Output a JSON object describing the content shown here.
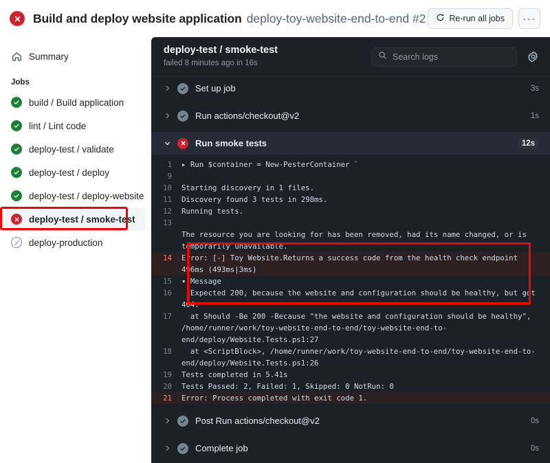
{
  "header": {
    "status_icon": "x-circle-icon",
    "status_color": "#cf222e",
    "title": "Build and deploy website application",
    "subtitle": "deploy-toy-website-end-to-end #2",
    "rerun_label": "Re-run all jobs",
    "rerun_icon": "sync-icon",
    "kebab_label": "···"
  },
  "sidebar": {
    "summary": {
      "label": "Summary",
      "icon": "home-icon"
    },
    "jobs_heading": "Jobs",
    "jobs": [
      {
        "label": "build / Build application",
        "status": "success",
        "icon": "check-circle-icon",
        "selected": false
      },
      {
        "label": "lint / Lint code",
        "status": "success",
        "icon": "check-circle-icon",
        "selected": false
      },
      {
        "label": "deploy-test / validate",
        "status": "success",
        "icon": "check-circle-icon",
        "selected": false
      },
      {
        "label": "deploy-test / deploy",
        "status": "success",
        "icon": "check-circle-icon",
        "selected": false
      },
      {
        "label": "deploy-test / deploy-website",
        "status": "success",
        "icon": "check-circle-icon",
        "selected": false
      },
      {
        "label": "deploy-test / smoke-test",
        "status": "failure",
        "icon": "x-circle-icon",
        "selected": true
      },
      {
        "label": "deploy-production",
        "status": "skipped",
        "icon": "skip-circle-icon",
        "selected": false
      }
    ]
  },
  "log_panel": {
    "job_name": "deploy-test / smoke-test",
    "job_status_line": "failed 8 minutes ago in 16s",
    "search": {
      "placeholder": "Search logs",
      "value": "",
      "icon": "search-icon"
    },
    "settings_icon": "gear-icon",
    "steps_top": [
      {
        "name": "Set up job",
        "duration": "3s",
        "status": "success",
        "expanded": false,
        "chevron": "chevron-right-icon"
      },
      {
        "name": "Run actions/checkout@v2",
        "duration": "1s",
        "status": "success",
        "expanded": false,
        "chevron": "chevron-right-icon"
      },
      {
        "name": "Run smoke tests",
        "duration": "12s",
        "status": "failure",
        "expanded": true,
        "chevron": "chevron-down-icon"
      }
    ],
    "steps_bottom": [
      {
        "name": "Post Run actions/checkout@v2",
        "duration": "0s",
        "status": "success",
        "expanded": false,
        "chevron": "chevron-right-icon"
      },
      {
        "name": "Complete job",
        "duration": "0s",
        "status": "success",
        "expanded": false,
        "chevron": "chevron-right-icon"
      }
    ],
    "log_lines": [
      {
        "n": "1",
        "text": "▸ Run $container = New-PesterContainer `",
        "error": false
      },
      {
        "n": "9",
        "text": "",
        "error": false
      },
      {
        "n": "10",
        "text": "Starting discovery in 1 files.",
        "error": false
      },
      {
        "n": "11",
        "text": "Discovery found 3 tests in 298ms.",
        "error": false
      },
      {
        "n": "12",
        "text": "Running tests.",
        "error": false
      },
      {
        "n": "13",
        "text": "",
        "error": false
      },
      {
        "n": "",
        "text": "The resource you are looking for has been removed, had its name changed, or is temporarily unavailable.",
        "error": false
      },
      {
        "n": "14",
        "text": "Error: [-] Toy Website.Returns a success code from the health check endpoint 496ms (493ms|3ms)",
        "error": true,
        "error_prefix": "Error:"
      },
      {
        "n": "15",
        "text": "▾ Message",
        "error": false
      },
      {
        "n": "16",
        "text": "  Expected 200, because the website and configuration should be healthy, but got 404.",
        "error": false
      },
      {
        "n": "17",
        "text": "  at Should -Be 200 -Because \"the website and configuration should be healthy\", /home/runner/work/toy-website-end-to-end/toy-website-end-to-end/deploy/Website.Tests.ps1:27",
        "error": false
      },
      {
        "n": "18",
        "text": "  at <ScriptBlock>, /home/runner/work/toy-website-end-to-end/toy-website-end-to-end/deploy/Website.Tests.ps1:26",
        "error": false
      },
      {
        "n": "19",
        "text": "Tests completed in 5.41s",
        "error": false
      },
      {
        "n": "20",
        "text": "Tests Passed: 2, Failed: 1, Skipped: 0 NotRun: 0",
        "error": false
      },
      {
        "n": "21",
        "text": "Error: Process completed with exit code 1.",
        "error": true,
        "error_prefix": "Error:"
      }
    ]
  },
  "annotations": {
    "color": "#ff0000",
    "sidebar_highlight_target": "deploy-test / smoke-test",
    "log_highlight_target": "Error: [-] Toy Website.Returns a success code from the health check endpoint"
  }
}
